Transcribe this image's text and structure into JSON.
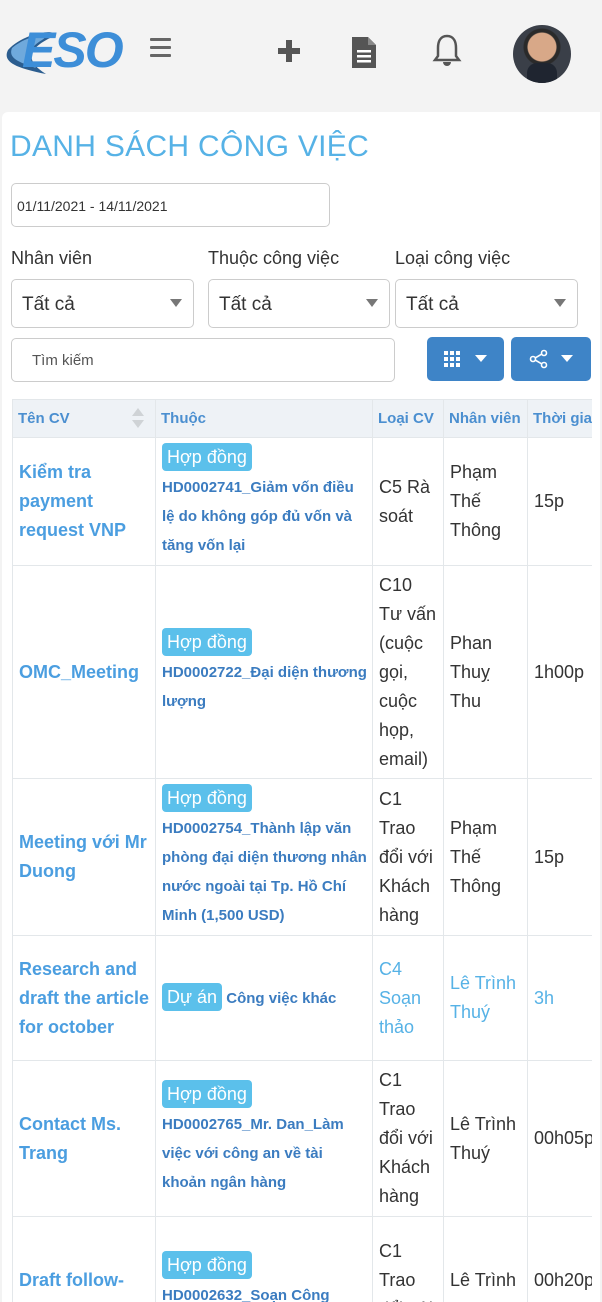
{
  "header": {
    "logo_text": "ESO",
    "icons": [
      "menu-icon",
      "plus-icon",
      "document-icon",
      "bell-icon",
      "avatar"
    ]
  },
  "page": {
    "title": "DANH SÁCH CÔNG VIỆC",
    "date_range": "01/11/2021 - 14/11/2021"
  },
  "filters": {
    "employee": {
      "label": "Nhân viên",
      "value": "Tất cả"
    },
    "belongs": {
      "label": "Thuộc công việc",
      "value": "Tất cả"
    },
    "type": {
      "label": "Loại công việc",
      "value": "Tất cả"
    }
  },
  "search": {
    "placeholder": "Tìm kiếm"
  },
  "table": {
    "headers": [
      "Tên CV",
      "Thuộc",
      "Loại CV",
      "Nhân viên",
      "Thời gian"
    ],
    "rows": [
      {
        "name": "Kiểm tra payment request VNP",
        "tag": "Hợp đồng",
        "link": "HD0002741_Giảm vốn điều lệ do không góp đủ vốn và tăng vốn lại",
        "type": "C5 Rà soát",
        "employee": "Phạm Thế Thông",
        "time": "15p"
      },
      {
        "name": "OMC_Meeting",
        "tag": "Hợp đồng",
        "link": "HD0002722_Đại diện thương lượng",
        "type": "C10 Tư vấn (cuộc gọi, cuộc họp, email)",
        "employee": "Phan Thuỵ Thu",
        "time": "1h00p"
      },
      {
        "name": "Meeting với Mr Duong",
        "tag": "Hợp đồng",
        "link": "HD0002754_Thành lập văn phòng đại diện thương nhân nước ngoài tại Tp. Hồ Chí Minh (1,500 USD)",
        "type": "C1 Trao đổi với Khách hàng",
        "employee": "Phạm Thế Thông",
        "time": "15p"
      },
      {
        "name": "Research and draft the article for october",
        "tag": "Dự án",
        "link": "Công việc khác",
        "type": "C4 Soạn thảo",
        "employee": "Lê Trình Thuý",
        "time": "3h"
      },
      {
        "name": "Contact Ms. Trang",
        "tag": "Hợp đồng",
        "link": "HD0002765_Mr. Dan_Làm việc với công an về tài khoản ngân hàng",
        "type": "C1 Trao đổi với Khách hàng",
        "employee": "Lê Trình Thuý",
        "time": "00h05p"
      },
      {
        "name": "Draft follow-",
        "tag": "Hợp đồng",
        "link": "HD0002632_Soạn Công",
        "type": "C1 Trao đổi với",
        "employee": "Lê Trình",
        "time": "00h20p"
      }
    ]
  }
}
